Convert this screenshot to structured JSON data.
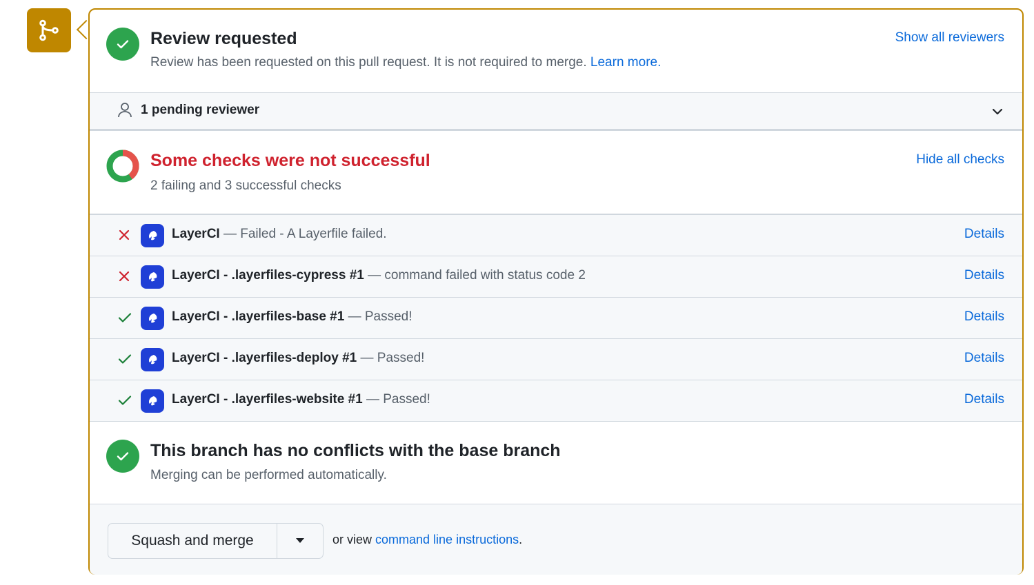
{
  "review": {
    "title": "Review requested",
    "subtitle": "Review has been requested on this pull request. It is not required to merge.",
    "learn_more": "Learn more.",
    "show_all": "Show all reviewers",
    "pending": "1 pending reviewer"
  },
  "checks": {
    "title": "Some checks were not successful",
    "subtitle": "2 failing and 3 successful checks",
    "hide_all": "Hide all checks",
    "items": [
      {
        "status": "failed",
        "name": "LayerCI",
        "desc": " — Failed - A Layerfile failed.",
        "details": "Details"
      },
      {
        "status": "failed",
        "name": "LayerCI - .layerfiles-cypress #1",
        "desc": " — command failed with status code 2",
        "details": "Details"
      },
      {
        "status": "passed",
        "name": "LayerCI - .layerfiles-base #1",
        "desc": " — Passed!",
        "details": "Details"
      },
      {
        "status": "passed",
        "name": "LayerCI - .layerfiles-deploy #1",
        "desc": " — Passed!",
        "details": "Details"
      },
      {
        "status": "passed",
        "name": "LayerCI - .layerfiles-website #1",
        "desc": " — Passed!",
        "details": "Details"
      }
    ]
  },
  "conflicts": {
    "title": "This branch has no conflicts with the base branch",
    "subtitle": "Merging can be performed automatically."
  },
  "merge": {
    "button": "Squash and merge",
    "hint_prefix": "or view ",
    "hint_link": "command line instructions",
    "hint_suffix": "."
  },
  "colors": {
    "accent": "#bf8700",
    "success": "#2da44e",
    "danger": "#cf222e",
    "link": "#0969da"
  }
}
